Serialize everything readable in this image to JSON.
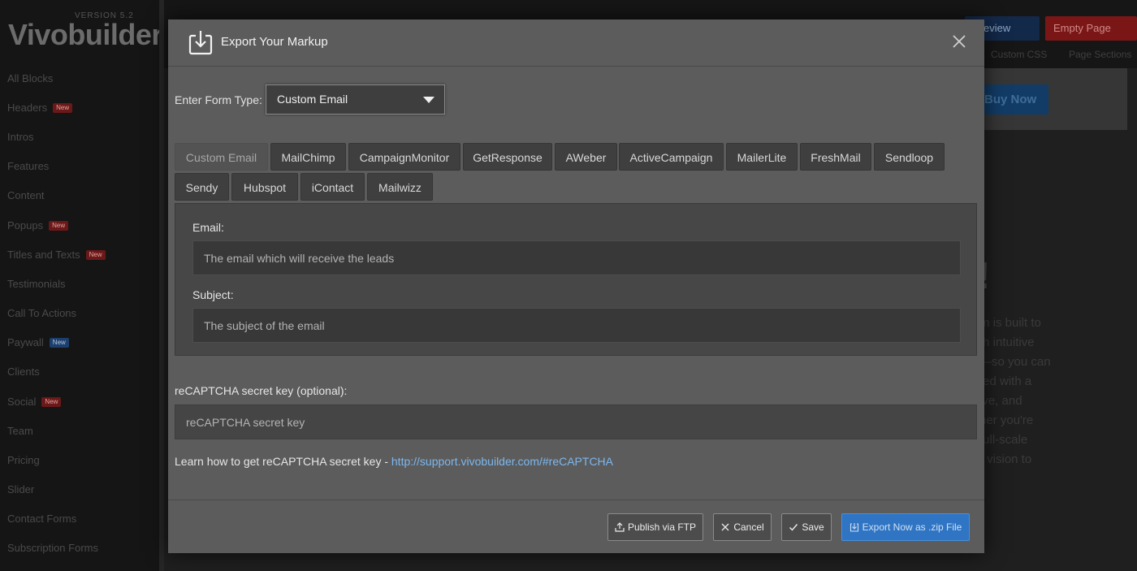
{
  "app": {
    "logo_version": "VERSION 5.2",
    "logo_text": "Vivobuilder",
    "sidebar_items": [
      {
        "label": "All Blocks",
        "badge": ""
      },
      {
        "label": "Headers",
        "badge": "New"
      },
      {
        "label": "Intros",
        "badge": ""
      },
      {
        "label": "Features",
        "badge": ""
      },
      {
        "label": "Content",
        "badge": ""
      },
      {
        "label": "Popups",
        "badge": "New"
      },
      {
        "label": "Titles and Texts",
        "badge": "New"
      },
      {
        "label": "Testimonials",
        "badge": ""
      },
      {
        "label": "Call To Actions",
        "badge": ""
      },
      {
        "label": "Paywall",
        "badge": "New"
      },
      {
        "label": "Clients",
        "badge": ""
      },
      {
        "label": "Social",
        "badge": "New"
      },
      {
        "label": "Team",
        "badge": ""
      },
      {
        "label": "Pricing",
        "badge": ""
      },
      {
        "label": "Slider",
        "badge": ""
      },
      {
        "label": "Contact Forms",
        "badge": ""
      },
      {
        "label": "Subscription Forms",
        "badge": ""
      }
    ],
    "top_buttons": {
      "preview": "Preview",
      "empty_page": "Empty Page"
    },
    "top_links": {
      "custom_css": "Custom CSS",
      "page_sections": "Page Sections"
    },
    "canvas": {
      "buy_now": "Buy Now",
      "heading_fragment": "r!",
      "para_lines": [
        "m is built to",
        "th intuitive",
        "—so you can",
        "ted with a",
        "ive, and",
        "her you're",
        "full-scale",
        "r vision to"
      ]
    }
  },
  "modal": {
    "title": "Export Your Markup",
    "form_type_label": "Enter Form Type:",
    "form_type_value": "Custom Email",
    "tabs_row1": [
      "Custom Email",
      "MailChimp",
      "CampaignMonitor",
      "GetResponse",
      "AWeber",
      "ActiveCampaign",
      "MailerLite",
      "FreshMail",
      "Sendloop"
    ],
    "tabs_row2": [
      "Sendy",
      "Hubspot",
      "iContact",
      "Mailwizz"
    ],
    "active_tab": "Custom Email",
    "email_label": "Email:",
    "email_placeholder": "The email which will receive the leads",
    "subject_label": "Subject:",
    "subject_placeholder": "The subject of the email",
    "recaptcha_label": "reCAPTCHA secret key (optional):",
    "recaptcha_placeholder": "reCAPTCHA secret key",
    "learn_text": "Learn how to get reCAPTCHA secret key - ",
    "learn_link": "http://support.vivobuilder.com/#reCAPTCHA",
    "buttons": {
      "publish_ftp": "Publish via FTP",
      "cancel": "Cancel",
      "save": "Save",
      "export_zip": "Export Now as .zip File"
    }
  },
  "colors": {
    "modal_bg": "#5c5c5c",
    "export_button": "#2f75c4",
    "link": "#7cb7ee"
  }
}
